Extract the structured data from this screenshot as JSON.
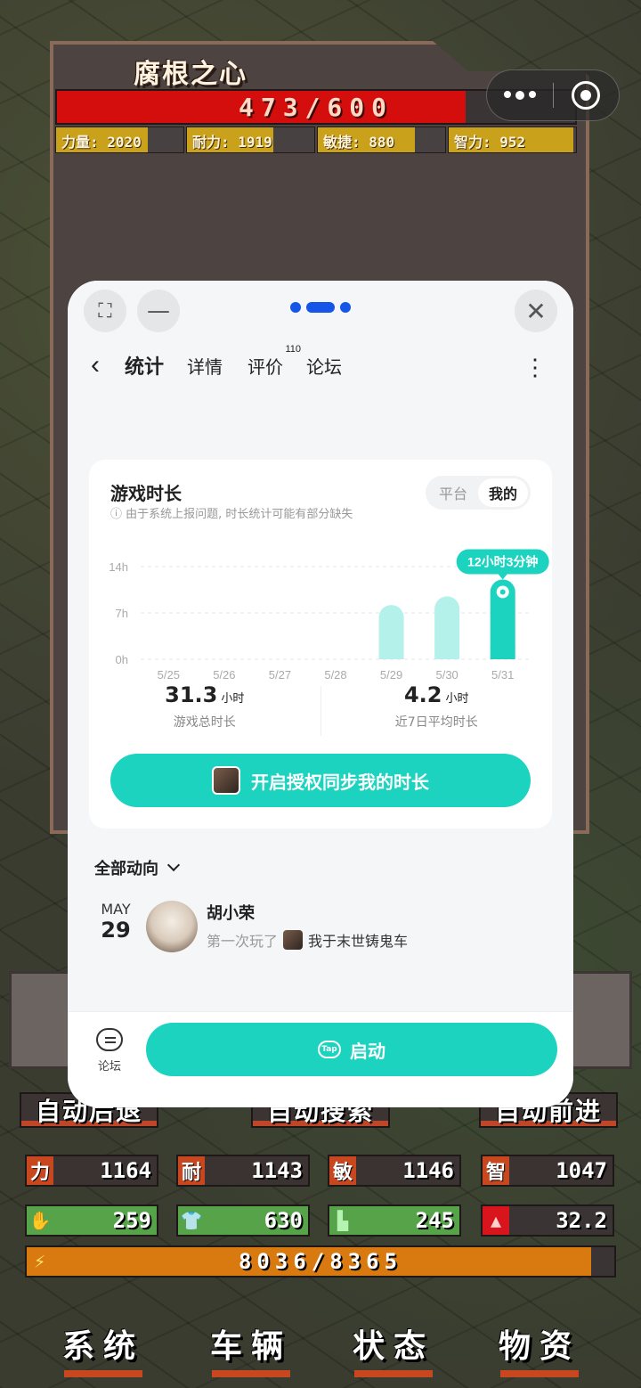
{
  "game": {
    "enemy_name": "腐根之心",
    "hp_text": "473/600",
    "hp_fraction": 0.788,
    "stats": [
      {
        "label": "力量: 2020",
        "fill": 0.72
      },
      {
        "label": "耐力: 1919",
        "fill": 0.68
      },
      {
        "label": "敏捷: 880",
        "fill": 0.76
      },
      {
        "label": "智力: 952",
        "fill": 0.98
      }
    ],
    "auto_buttons": [
      "自动后退",
      "自动搜索",
      "自动前进"
    ],
    "attributes": [
      {
        "tag": "力",
        "value": "1164"
      },
      {
        "tag": "耐",
        "value": "1143"
      },
      {
        "tag": "敏",
        "value": "1146"
      },
      {
        "tag": "智",
        "value": "1047"
      }
    ],
    "resources": [
      {
        "icon": "glove-icon",
        "value": "259"
      },
      {
        "icon": "shirt-icon",
        "value": "630"
      },
      {
        "icon": "boot-icon",
        "value": "245"
      },
      {
        "icon": "helmet-icon",
        "value": "32.2"
      }
    ],
    "energy_text": "8036/8365",
    "energy_fraction": 0.96,
    "menu": [
      "系统",
      "车辆",
      "状态",
      "物资"
    ]
  },
  "sheet": {
    "tabs": [
      {
        "label": "统计",
        "active": true
      },
      {
        "label": "详情"
      },
      {
        "label": "评价",
        "badge": "110"
      },
      {
        "label": "论坛"
      }
    ],
    "card": {
      "title": "游戏时长",
      "note": "ⓘ 由于系统上报问题, 时长统计可能有部分缺失",
      "segments": [
        "平台",
        "我的"
      ],
      "selected_segment": "我的",
      "total_value": "31.3",
      "total_unit": "小时",
      "total_caption": "游戏总时长",
      "avg_value": "4.2",
      "avg_unit": "小时",
      "avg_caption": "近7日平均时长",
      "sync_label": "开启授权同步我的时长"
    },
    "feed_heading": "全部动向",
    "feed": [
      {
        "month": "MAY",
        "day": "29",
        "name": "胡小荣",
        "action": "第一次玩了",
        "game": "我于末世铸鬼车"
      }
    ],
    "forum_label": "论坛",
    "launch_label": "启动",
    "tap_logo": "Tap"
  },
  "chart_data": {
    "type": "bar",
    "categories": [
      "5/25",
      "5/26",
      "5/27",
      "5/28",
      "5/29",
      "5/30",
      "5/31"
    ],
    "values": [
      0,
      0,
      0,
      0,
      8.2,
      9.5,
      12.05
    ],
    "y_ticks": [
      "14h",
      "7h",
      "0h"
    ],
    "ylim": [
      0,
      14
    ],
    "highlight_label": "12小时3分钟",
    "colors": {
      "bar": "#b3f1ea",
      "highlight": "#1cd3c0"
    }
  }
}
